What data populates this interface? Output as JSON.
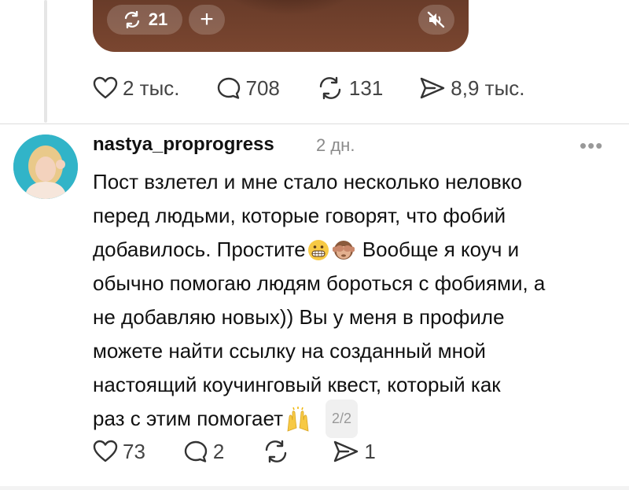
{
  "media": {
    "repost_count": "21",
    "add_label": "+",
    "mute_icon": "speaker-muted-icon"
  },
  "top_actions": {
    "likes": "2 тыс.",
    "replies": "708",
    "reposts": "131",
    "shares": "8,9 тыс."
  },
  "reply": {
    "username": "nastya_proprogress",
    "time": "2 дн.",
    "more": "•••",
    "lines": [
      "Пост взлетел и мне стало несколько неловко",
      "перед людьми, которые говорят, что фобий",
      "добавилось. Простите",
      "Вообще я коуч и",
      "обычно помогаю людям бороться с фобиями, а",
      "не добавляю новых)) Вы у меня в профиле",
      "можете найти ссылку на созданный мной",
      "настоящий коучинговый квест, который как",
      "раз с этим помогает"
    ],
    "page": "2/2",
    "actions": {
      "likes": "73",
      "replies": "2",
      "reposts": "",
      "shares": "1"
    }
  }
}
